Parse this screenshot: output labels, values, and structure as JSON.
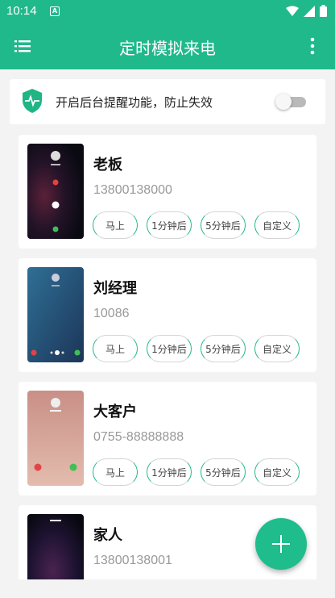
{
  "status_bar": {
    "time": "10:14",
    "notification_icon": "notification-a-icon",
    "icons": [
      "wifi-icon",
      "signal-icon",
      "battery-icon"
    ]
  },
  "app_bar": {
    "title": "定时模拟来电",
    "menu_icon": "menu-icon",
    "more_icon": "more-vert-icon"
  },
  "notice": {
    "text": "开启后台提醒功能，防止失效",
    "icon": "shield-icon",
    "toggle_on": false
  },
  "buttons": {
    "now": "马上",
    "one_min": "1分钟后",
    "five_min": "5分钟后",
    "custom": "自定义"
  },
  "contacts": [
    {
      "name": "老板",
      "number": "13800138000",
      "theme": "dark-red"
    },
    {
      "name": "刘经理",
      "number": "10086",
      "theme": "blue"
    },
    {
      "name": "大客户",
      "number": "0755-88888888",
      "theme": "peach"
    },
    {
      "name": "家人",
      "number": "13800138001",
      "theme": "dark-purple"
    }
  ],
  "fab": {
    "icon": "plus-icon"
  },
  "colors": {
    "accent": "#20b98b",
    "card": "#ffffff",
    "background": "#f3f3f3"
  }
}
